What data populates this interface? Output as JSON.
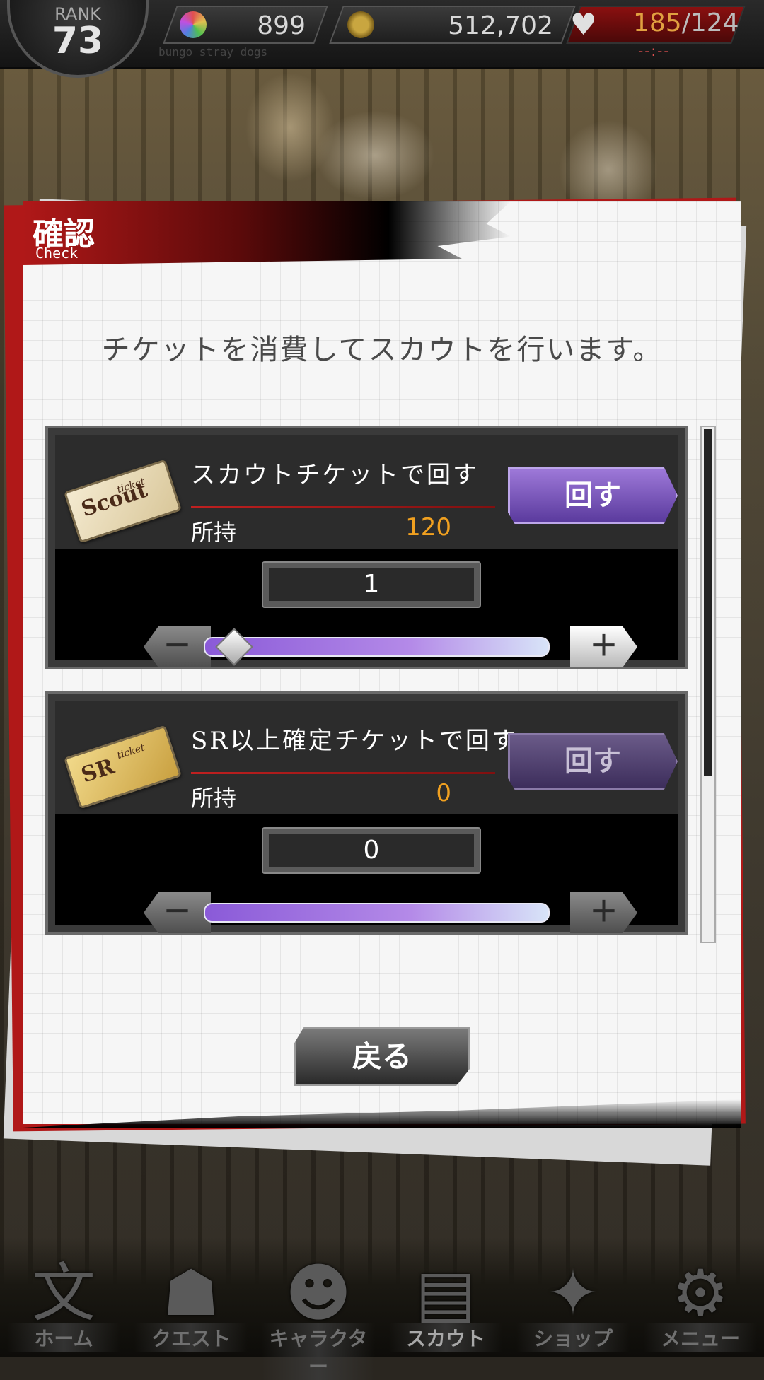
{
  "status_bar": {
    "rank_label": "RANK",
    "rank_value": "73",
    "gems": "899",
    "coins": "512,702",
    "stamina_current": "185",
    "stamina_max": "124",
    "stamina_separator": "/",
    "stamina_timer": "--:--",
    "subtitle": "bungo stray dogs"
  },
  "dialog": {
    "title": "確認",
    "title_en": "Check",
    "message": "チケットを消費してスカウトを行います。"
  },
  "tickets": [
    {
      "icon_text": "Scout",
      "icon_sub": "ticket",
      "label": "スカウトチケットで回す",
      "own_label": "所持",
      "own_value": "120",
      "spin_label": "回す",
      "quantity": "1",
      "minus": "－",
      "plus": "＋",
      "slider_value": 1,
      "slider_max": 120
    },
    {
      "icon_text": "SR",
      "icon_sub": "ticket",
      "label": "SR以上確定チケットで回す",
      "own_label": "所持",
      "own_value": "0",
      "spin_label": "回す",
      "quantity": "0",
      "minus": "－",
      "plus": "＋",
      "slider_value": 0,
      "slider_max": 0
    }
  ],
  "back_button": "戻る",
  "nav": [
    {
      "label": "ホーム",
      "icon": "home-icon"
    },
    {
      "label": "クエスト",
      "icon": "quest-icon"
    },
    {
      "label": "キャラクター",
      "icon": "character-icon"
    },
    {
      "label": "スカウト",
      "icon": "scout-icon"
    },
    {
      "label": "ショップ",
      "icon": "shop-icon"
    },
    {
      "label": "メニュー",
      "icon": "menu-icon"
    }
  ],
  "colors": {
    "accent_red": "#b01818",
    "button_purple": "#7b5bc0",
    "value_orange": "#f0a020"
  }
}
